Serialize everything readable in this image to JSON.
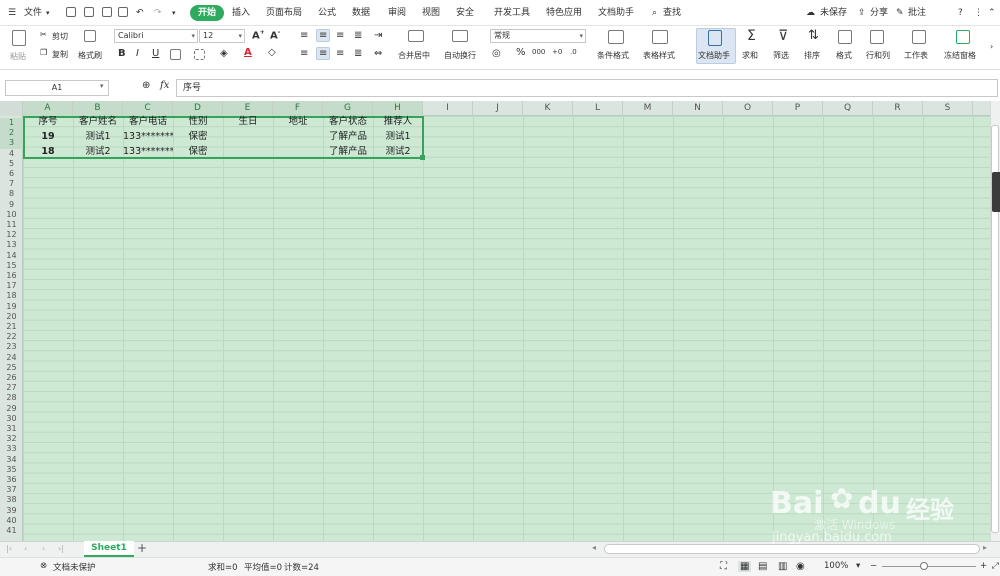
{
  "menubar": {
    "file": "文件",
    "tabs": [
      "开始",
      "插入",
      "页面布局",
      "公式",
      "数据",
      "审阅",
      "视图",
      "安全",
      "开发工具",
      "特色应用",
      "文档助手"
    ],
    "active_tab": "开始",
    "search": "查找",
    "unsaved": "未保存",
    "share": "分享",
    "annotate": "批注"
  },
  "ribbon": {
    "paste": "粘贴",
    "cut": "剪切",
    "copy": "复制",
    "format_painter": "格式刷",
    "font_name": "Calibri",
    "font_size": "12",
    "merge_center": "合并居中",
    "wrap_text": "自动换行",
    "number_format": "常规",
    "cond_format": "条件格式",
    "table_style": "表格样式",
    "doc_assistant": "文档助手",
    "sum": "求和",
    "filter": "筛选",
    "sort": "排序",
    "format": "格式",
    "rows_cols": "行和列",
    "worksheet": "工作表",
    "freeze": "冻结窗格",
    "bold": "B",
    "italic": "I",
    "underline": "U",
    "font_color_letter": "A",
    "percent": "%",
    "thousands": "000"
  },
  "formula_bar": {
    "name_box": "A1",
    "fx": "fx",
    "value": "序号"
  },
  "columns": [
    "A",
    "B",
    "C",
    "D",
    "E",
    "F",
    "G",
    "H",
    "I",
    "J",
    "K",
    "L",
    "M",
    "N",
    "O",
    "P",
    "Q",
    "R",
    "S"
  ],
  "rows": [
    "1",
    "2",
    "3",
    "4",
    "5",
    "6",
    "7",
    "8",
    "9",
    "10",
    "11",
    "12",
    "13",
    "14",
    "15",
    "16",
    "17",
    "18",
    "19",
    "20",
    "21",
    "22",
    "23",
    "24",
    "25",
    "26",
    "27",
    "28",
    "29",
    "30",
    "31",
    "32",
    "33",
    "34",
    "35",
    "36",
    "37",
    "38",
    "39",
    "40",
    "41"
  ],
  "table": {
    "headers": [
      "序号",
      "客户姓名",
      "客户电话",
      "性别",
      "生日",
      "地址",
      "客户状态",
      "推荐人"
    ],
    "rows": [
      [
        "19",
        "测试1",
        "133*******",
        "保密",
        "",
        "",
        "了解产品",
        "测试1"
      ],
      [
        "18",
        "测试2",
        "133*******",
        "保密",
        "",
        "",
        "了解产品",
        "测试2"
      ]
    ]
  },
  "sheet_tabs": [
    "Sheet1"
  ],
  "status": {
    "protect": "文档未保护",
    "sum": "求和=0",
    "avg": "平均值=0",
    "count": "计数=24",
    "zoom": "100%"
  },
  "watermark": {
    "brand": "Bai",
    "brand2": "du",
    "cn": "经验",
    "url": "jingyan.baidu.com",
    "activate": "激活 Windows"
  },
  "colors": {
    "accent": "#2eab5e",
    "sheet_bg": "#cde8d3",
    "selection_border": "#35a35a"
  }
}
